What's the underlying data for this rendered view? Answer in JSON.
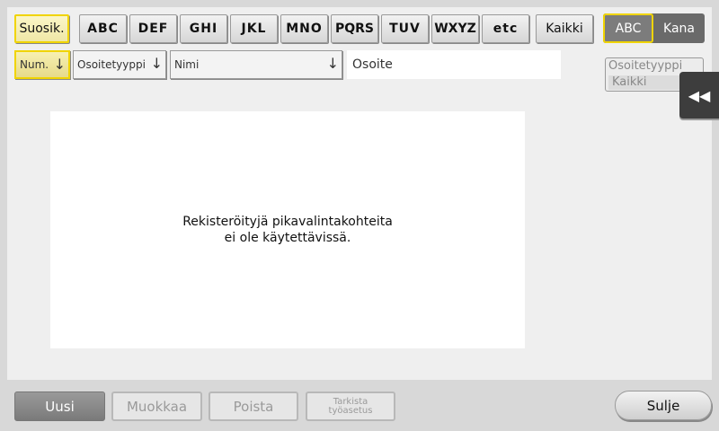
{
  "tabs": {
    "favorites": "Suosik.",
    "alpha": [
      "ABC",
      "DEF",
      "GHI",
      "JKL",
      "MNO",
      "PQRS",
      "TUV",
      "WXYZ",
      "etc"
    ],
    "all": "Kaikki"
  },
  "toggle": {
    "abc": "ABC",
    "kana": "Kana"
  },
  "columns": {
    "num": "Num.",
    "address_type": "Osoitetyyppi",
    "name": "Nimi",
    "address": "Osoite"
  },
  "type_filter": {
    "label": "Osoitetyyppi",
    "value": "Kaikki"
  },
  "empty_message": {
    "line1": "Rekisteröityjä pikavalintakohteita",
    "line2": "ei ole käytettävissä."
  },
  "footer": {
    "new": "Uusi",
    "edit": "Muokkaa",
    "delete": "Poista",
    "check_line1": "Tarkista",
    "check_line2": "työasetus",
    "close": "Sulje"
  },
  "icons": {
    "sort": "arrow-down-icon",
    "collapse": "double-left-arrow-icon"
  },
  "colors": {
    "highlight": "#f0d400",
    "primary": "#8a8a8a"
  }
}
